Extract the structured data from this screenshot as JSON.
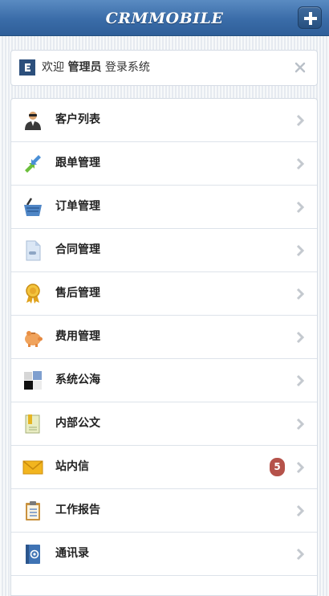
{
  "app": {
    "brand": "CRMMOBILE"
  },
  "header": {
    "add_icon": "plus-icon"
  },
  "welcome": {
    "prefix": "欢迎",
    "user": "管理员",
    "suffix": "登录系统",
    "logo_icon": "app-logo-icon",
    "close_icon": "close-icon"
  },
  "menu": {
    "items": [
      {
        "label": "客户列表",
        "icon": "customer-person-icon"
      },
      {
        "label": "跟单管理",
        "icon": "follow-up-arrows-icon"
      },
      {
        "label": "订单管理",
        "icon": "shopping-basket-icon"
      },
      {
        "label": "合同管理",
        "icon": "document-icon"
      },
      {
        "label": "售后管理",
        "icon": "award-ribbon-icon"
      },
      {
        "label": "费用管理",
        "icon": "piggy-bank-icon"
      },
      {
        "label": "系统公海",
        "icon": "grid-squares-icon"
      },
      {
        "label": "内部公文",
        "icon": "notebook-icon"
      },
      {
        "label": "站内信",
        "icon": "envelope-icon",
        "badge": "5"
      },
      {
        "label": "工作报告",
        "icon": "clipboard-icon"
      },
      {
        "label": "通讯录",
        "icon": "address-book-icon"
      }
    ]
  },
  "colors": {
    "header": "#3a6ca8",
    "badge": "#b5524a"
  }
}
